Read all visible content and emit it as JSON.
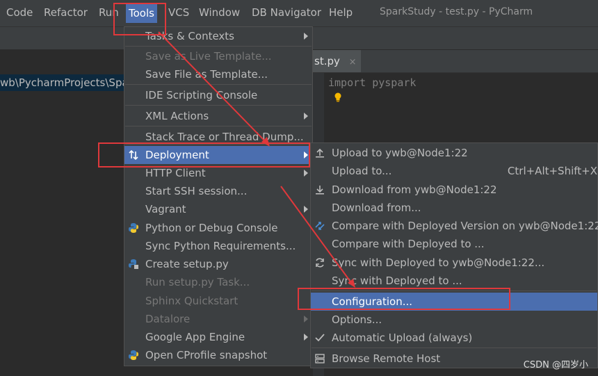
{
  "window": {
    "title": "SparkStudy - test.py - PyCharm"
  },
  "menubar": [
    "Code",
    "Refactor",
    "Run",
    "Tools",
    "VCS",
    "Window",
    "DB Navigator",
    "Help"
  ],
  "project": {
    "path": "wb\\PycharmProjects\\Spar"
  },
  "editor": {
    "tab": "st.py",
    "tab_close": "×",
    "code_line": "import pyspark"
  },
  "tools_menu": [
    {
      "label": "Tasks & Contexts",
      "submenu": true
    },
    {
      "label": "Save as Live Template...",
      "disabled": true
    },
    {
      "label": "Save File as Template..."
    },
    {
      "label": "IDE Scripting Console"
    },
    {
      "label": "XML Actions",
      "submenu": true
    },
    {
      "label": "Stack Trace or Thread Dump..."
    },
    {
      "label": "Deployment",
      "submenu": true,
      "selected": true,
      "icon": "deployment-icon"
    },
    {
      "label": "HTTP Client",
      "submenu": true
    },
    {
      "label": "Start SSH session..."
    },
    {
      "label": "Vagrant",
      "submenu": true
    },
    {
      "label": "Python or Debug Console",
      "icon": "python-icon"
    },
    {
      "label": "Sync Python Requirements..."
    },
    {
      "label": "Create setup.py",
      "icon": "python-setup-icon"
    },
    {
      "label": "Run setup.py Task...",
      "disabled": true
    },
    {
      "label": "Sphinx Quickstart",
      "disabled": true
    },
    {
      "label": "Datalore",
      "disabled": true,
      "submenu": true
    },
    {
      "label": "Google App Engine",
      "submenu": true
    },
    {
      "label": "Open CProfile snapshot",
      "icon": "python-icon"
    }
  ],
  "deployment_menu": [
    {
      "label": "Upload to ywb@Node1:22",
      "icon": "upload-icon"
    },
    {
      "label": "Upload to...",
      "shortcut": "Ctrl+Alt+Shift+X"
    },
    {
      "label": "Download from ywb@Node1:22",
      "icon": "download-icon"
    },
    {
      "label": "Download from..."
    },
    {
      "label": "Compare with Deployed Version on ywb@Node1:22",
      "icon": "compare-icon"
    },
    {
      "label": "Compare with Deployed to ..."
    },
    {
      "label": "Sync with Deployed to ywb@Node1:22...",
      "icon": "sync-icon"
    },
    {
      "label": "Sync with Deployed to ..."
    },
    {
      "label": "Configuration...",
      "selected": true
    },
    {
      "label": "Options..."
    },
    {
      "label": "Automatic Upload (always)",
      "icon": "check-icon"
    },
    {
      "label": "Browse Remote Host",
      "icon": "remote-host-icon"
    }
  ],
  "watermark": "CSDN @四岁小",
  "colors": {
    "selection": "#4b6eaf",
    "annotation": "#e0383b",
    "background": "#3c3f41"
  }
}
